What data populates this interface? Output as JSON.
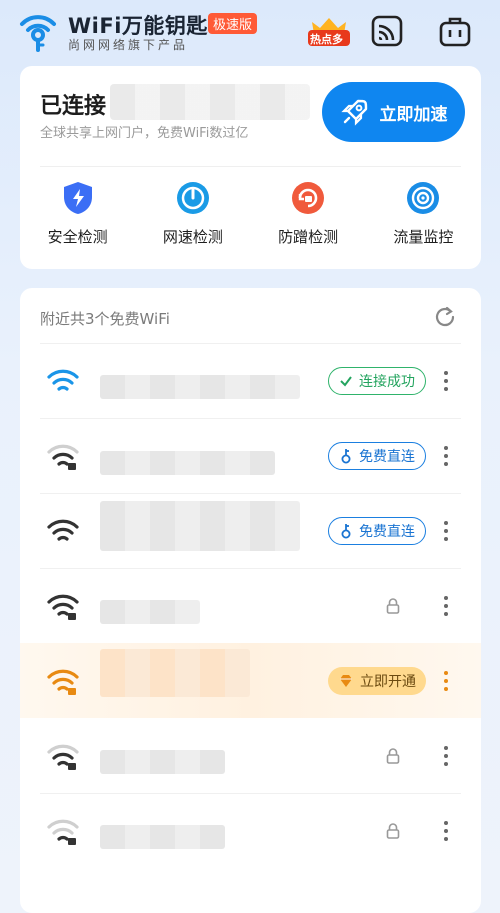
{
  "header": {
    "brand": "WiFi万能钥匙",
    "badge": "极速版",
    "slogan": "尚网网络旗下产品",
    "vip_label": "热点多"
  },
  "connection": {
    "status": "已连接",
    "subtitle": "全球共享上网门户，免费WiFi数过亿",
    "boost_label": "立即加速"
  },
  "tools": [
    {
      "label": "安全检测",
      "icon": "shield-icon",
      "color": "#3b6ef5"
    },
    {
      "label": "网速检测",
      "icon": "speedometer-icon",
      "color": "#1a9be6"
    },
    {
      "label": "防蹭检测",
      "icon": "anti-leech-icon",
      "color": "#f05a3c"
    },
    {
      "label": "流量监控",
      "icon": "traffic-icon",
      "color": "#1a8de6"
    }
  ],
  "nearby": {
    "title": "附近共3个免费WiFi",
    "networks": [
      {
        "status": "connected",
        "action": "连接成功",
        "wifi_color": "#1a95e8"
      },
      {
        "status": "free",
        "action": "免费直连",
        "wifi_color": "#333333"
      },
      {
        "status": "free",
        "action": "免费直连",
        "wifi_color": "#333333"
      },
      {
        "status": "locked",
        "action": "",
        "wifi_color": "#333333"
      },
      {
        "status": "vip",
        "action": "立即开通",
        "wifi_color": "#e88a12"
      },
      {
        "status": "locked",
        "action": "",
        "wifi_color": "#333333"
      },
      {
        "status": "locked",
        "action": "",
        "wifi_color": "#333333"
      }
    ]
  },
  "colors": {
    "accent": "#0f86f0",
    "success": "#2fb36b",
    "vip": "#ffd98e",
    "brand_badge": "#ff5a36"
  }
}
